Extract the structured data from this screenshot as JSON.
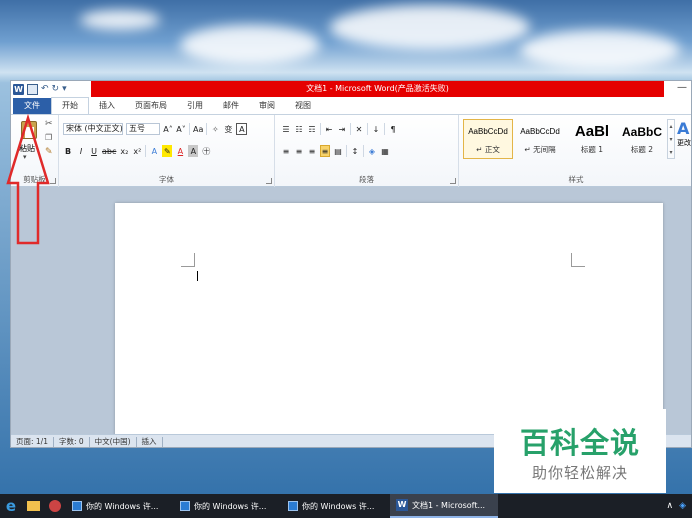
{
  "window": {
    "title": "文档1 - Microsoft Word(产品激活失败)"
  },
  "quick_access": {
    "icons": [
      "word-icon",
      "save-icon",
      "undo-icon",
      "redo-icon",
      "customize-icon"
    ]
  },
  "tabs": [
    "文件",
    "开始",
    "插入",
    "页面布局",
    "引用",
    "邮件",
    "审阅",
    "视图"
  ],
  "active_tab": "开始",
  "ribbon": {
    "clipboard": {
      "paste_label": "粘贴",
      "group_label": "剪贴板"
    },
    "font": {
      "font_name": "宋体 (中文正文)",
      "font_size": "五号",
      "grow": "A˄",
      "shrink": "A˅",
      "change_case": "Aa",
      "bold": "B",
      "italic": "I",
      "underline": "U",
      "strike": "abc",
      "subscript": "x₂",
      "superscript": "x²",
      "group_label": "字体"
    },
    "paragraph": {
      "group_label": "段落"
    },
    "styles": {
      "items": [
        {
          "sample": "AaBbCcDd",
          "name": "↵ 正文"
        },
        {
          "sample": "AaBbCcDd",
          "name": "↵ 无间隔"
        },
        {
          "sample": "AaBl",
          "name": "标题 1"
        },
        {
          "sample": "AaBbC",
          "name": "标题 2"
        }
      ],
      "change_styles": "更改样式",
      "group_label": "样式"
    }
  },
  "status": {
    "page": "页面: 1/1",
    "words": "字数: 0",
    "language": "中文(中国)",
    "mode": "插入"
  },
  "watermark": {
    "title": "百科全说",
    "subtitle": "助你轻松解决"
  },
  "taskbar": {
    "items": [
      {
        "label": "你的 Windows 许...",
        "active": false
      },
      {
        "label": "你的 Windows 许...",
        "active": false
      },
      {
        "label": "你的 Windows 许...",
        "active": false
      },
      {
        "label": "文档1 - Microsoft...",
        "active": true
      }
    ]
  }
}
